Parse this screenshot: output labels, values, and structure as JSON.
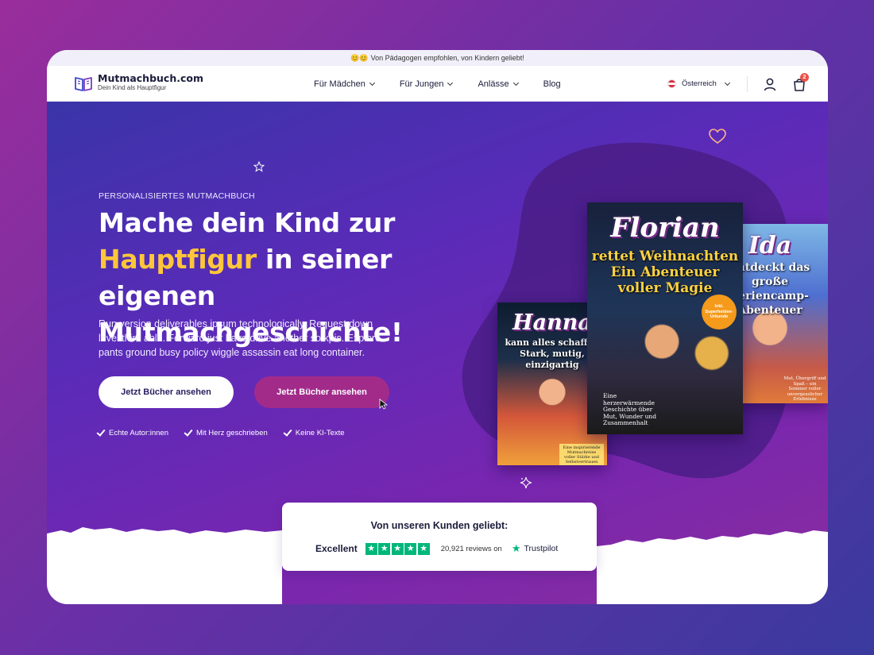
{
  "announcement": {
    "emoji": "😊😊",
    "text": "Von Pädagogen empfohlen, von Kindern geliebt!"
  },
  "header": {
    "logo_title": "Mutmachbuch.com",
    "logo_subtitle": "Dein Kind als Hauptfigur",
    "nav": [
      {
        "label": "Für Mädchen"
      },
      {
        "label": "Für Jungen"
      },
      {
        "label": "Anlässe"
      },
      {
        "label": "Blog"
      }
    ],
    "country": "Österreich",
    "cart_count": "2"
  },
  "hero": {
    "eyebrow": "PERSONALISIERTES MUTMACHBUCH",
    "headline_line1": "Mache dein Kind zur",
    "headline_highlight": "Hauptfigur",
    "headline_line2_rest": " in seiner eigenen",
    "headline_line3": "Mutmachgeschichte!",
    "description": "Run version deliverables ipsum technologically. Request down level third able. Forward just have drive another so kpis. Explore pants ground busy policy wiggle assassin eat long container.",
    "primary_button": "Jetzt Bücher ansehen",
    "secondary_button": "Jetzt Bücher ansehen",
    "checks": [
      "Echte Autor:innen",
      "Mit Herz geschrieben",
      "Keine KI-Texte"
    ]
  },
  "books": {
    "florian": {
      "name": "Florian",
      "subtitle": "rettet Weihnachten Ein Abenteuer voller Magie",
      "blurb": "Eine herzerwärmende Geschichte über Mut, Wunder und Zusammenhalt",
      "seal": "Inkl. Superhelden-Urkunde"
    },
    "ida": {
      "name": "Ida",
      "subtitle": "entdeckt das große Feriencamp-Abenteuer",
      "blurb": "Mut, Übergriff und Spaß – ein Sommer voller unvergesslicher Erlebnisse"
    },
    "hanna": {
      "name": "Hanna",
      "subtitle": "kann alles schaffen Stark, mutig, einzigartig",
      "blurb": "Eine inspirierende Mutmachreise voller Stärke und Selbstvertrauen"
    }
  },
  "trust": {
    "title": "Von unseren Kunden geliebt:",
    "rating_label": "Excellent",
    "stars": 5,
    "reviews": "20,921 reviews on",
    "brand": "Trustpilot"
  },
  "colors": {
    "accent_yellow": "#ffc63a",
    "button_magenta": "#a22b8a",
    "trustpilot_green": "#00b67a"
  }
}
